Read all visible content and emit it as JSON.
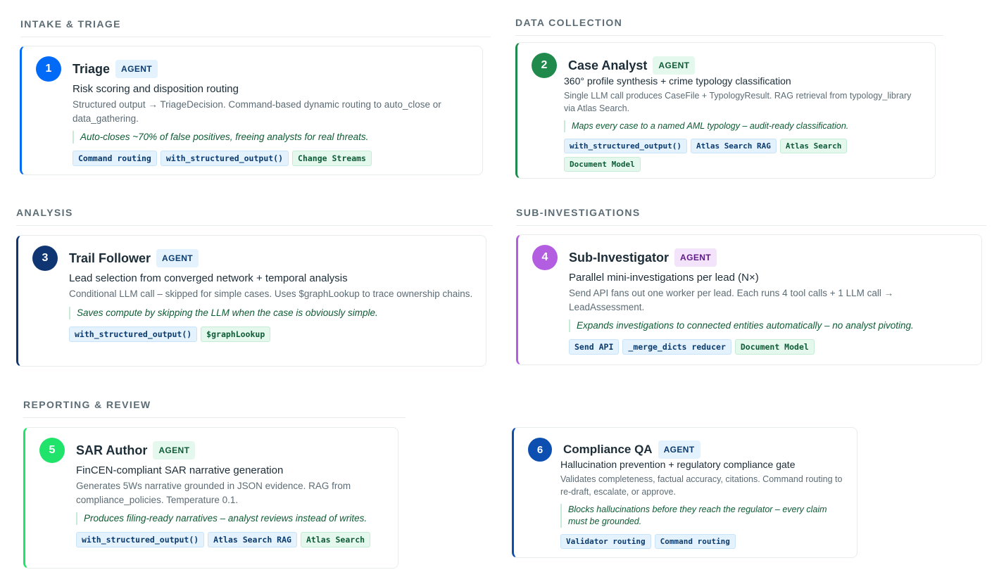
{
  "sections": {
    "intake": "INTAKE & TRIAGE",
    "data_collection": "DATA COLLECTION",
    "analysis": "ANALYSIS",
    "sub_investigations": "SUB-INVESTIGATIONS",
    "reporting": "REPORTING & REVIEW"
  },
  "colors": {
    "blue": "#016bf8",
    "green": "#1f8a4c",
    "navy": "#0f3573",
    "purple": "#b35ee0",
    "bright_green": "#20e36b",
    "royal": "#0d4fb0"
  },
  "cards": [
    {
      "number": "1",
      "title": "Triage",
      "badge": "AGENT",
      "subtitle": "Risk scoring and disposition routing",
      "description": "Structured output → TriageDecision. Command-based dynamic routing to auto_close or data_gathering.",
      "quote": "Auto-closes ~70% of false positives, freeing analysts for real threats.",
      "tags": [
        "Command routing",
        "with_structured_output()",
        "Change Streams"
      ]
    },
    {
      "number": "2",
      "title": "Case Analyst",
      "badge": "AGENT",
      "subtitle": "360° profile synthesis + crime typology classification",
      "description": "Single LLM call produces CaseFile + TypologyResult. RAG retrieval from typology_library via Atlas Search.",
      "quote": "Maps every case to a named AML typology – audit-ready classification.",
      "tags": [
        "with_structured_output()",
        "Atlas Search RAG",
        "Atlas Search",
        "Document Model"
      ]
    },
    {
      "number": "3",
      "title": "Trail Follower",
      "badge": "AGENT",
      "subtitle": "Lead selection from converged network + temporal analysis",
      "description": "Conditional LLM call – skipped for simple cases. Uses $graphLookup to trace ownership chains.",
      "quote": "Saves compute by skipping the LLM when the case is obviously simple.",
      "tags": [
        "with_structured_output()",
        "$graphLookup"
      ]
    },
    {
      "number": "4",
      "title": "Sub-Investigator",
      "badge": "AGENT",
      "subtitle": "Parallel mini-investigations per lead (N×)",
      "description": "Send API fans out one worker per lead. Each runs 4 tool calls + 1 LLM call → LeadAssessment.",
      "quote": "Expands investigations to connected entities automatically – no analyst pivoting.",
      "tags": [
        "Send API",
        "_merge_dicts reducer",
        "Document Model"
      ]
    },
    {
      "number": "5",
      "title": "SAR Author",
      "badge": "AGENT",
      "subtitle": "FinCEN-compliant SAR narrative generation",
      "description": "Generates 5Ws narrative grounded in JSON evidence. RAG from compliance_policies. Temperature 0.1.",
      "quote": "Produces filing-ready narratives – analyst reviews instead of writes.",
      "tags": [
        "with_structured_output()",
        "Atlas Search RAG",
        "Atlas Search"
      ]
    },
    {
      "number": "6",
      "title": "Compliance QA",
      "badge": "AGENT",
      "subtitle": "Hallucination prevention + regulatory compliance gate",
      "description": "Validates completeness, factual accuracy, citations. Command routing to re-draft, escalate, or approve.",
      "quote": "Blocks hallucinations before they reach the regulator – every claim must be grounded.",
      "tags": [
        "Validator routing",
        "Command routing"
      ]
    }
  ]
}
